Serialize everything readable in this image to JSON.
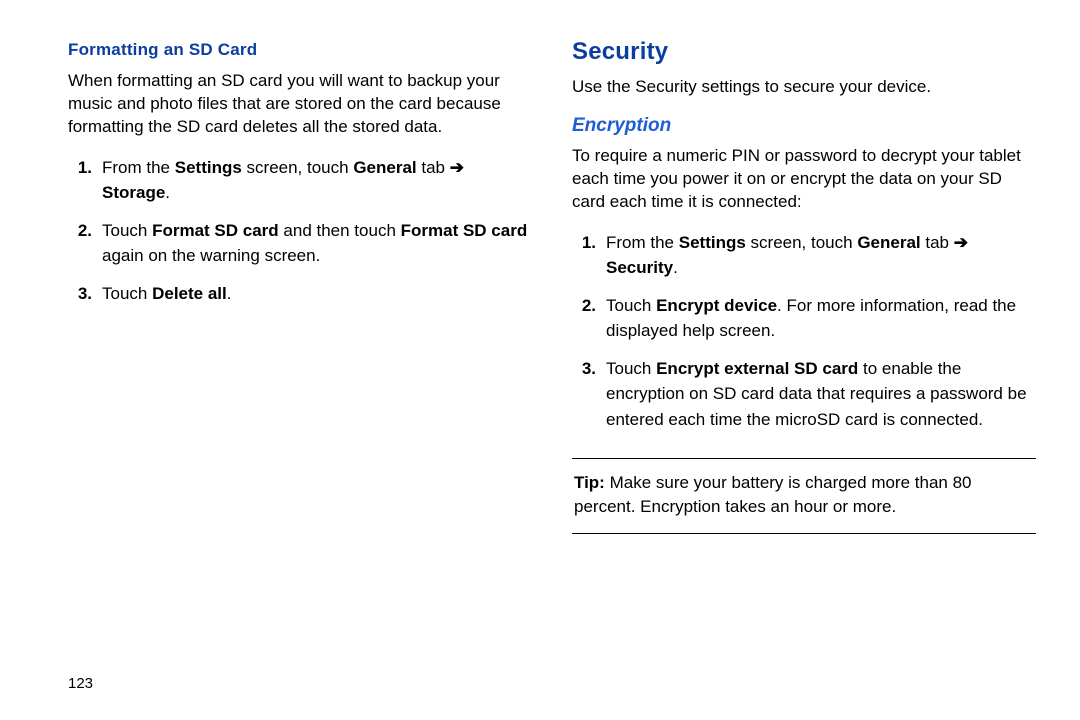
{
  "left": {
    "heading": "Formatting an SD Card",
    "intro": "When formatting an SD card you will want to backup your music and photo files that are stored on the card because formatting the SD card deletes all the stored data.",
    "arrow": "➔",
    "items": [
      {
        "num": "1.",
        "pre": "From the ",
        "b1": "Settings",
        "mid1": " screen, touch ",
        "b2": "General",
        "mid2": " tab ",
        "b3": "Storage",
        "post": "."
      },
      {
        "num": "2.",
        "pre": "Touch ",
        "b1": "Format SD card",
        "mid1": " and then touch ",
        "b2": "Format SD card",
        "mid2": " again on the warning screen."
      },
      {
        "num": "3.",
        "pre": "Touch ",
        "b1": "Delete all",
        "post": "."
      }
    ],
    "pagenum": "123"
  },
  "right": {
    "title": "Security",
    "intro": "Use the Security settings to secure your device.",
    "subheading": "Encryption",
    "subintro": "To require a numeric PIN or password to decrypt your tablet each time you power it on or encrypt the data on your SD card each time it is connected:",
    "arrow": "➔",
    "items": [
      {
        "num": "1.",
        "pre": "From the ",
        "b1": "Settings",
        "mid1": " screen, touch ",
        "b2": "General",
        "mid2": " tab ",
        "b3": "Security",
        "post": "."
      },
      {
        "num": "2.",
        "pre": "Touch ",
        "b1": "Encrypt device",
        "mid1": ". For more information, read the displayed help screen."
      },
      {
        "num": "3.",
        "pre": "Touch ",
        "b1": "Encrypt external SD card",
        "mid1": " to enable the encryption on SD card data that requires a password be entered each time the microSD card is connected."
      }
    ],
    "tip_label": "Tip:",
    "tip_text": " Make sure your battery is charged more than 80 percent. Encryption takes an hour or more."
  }
}
